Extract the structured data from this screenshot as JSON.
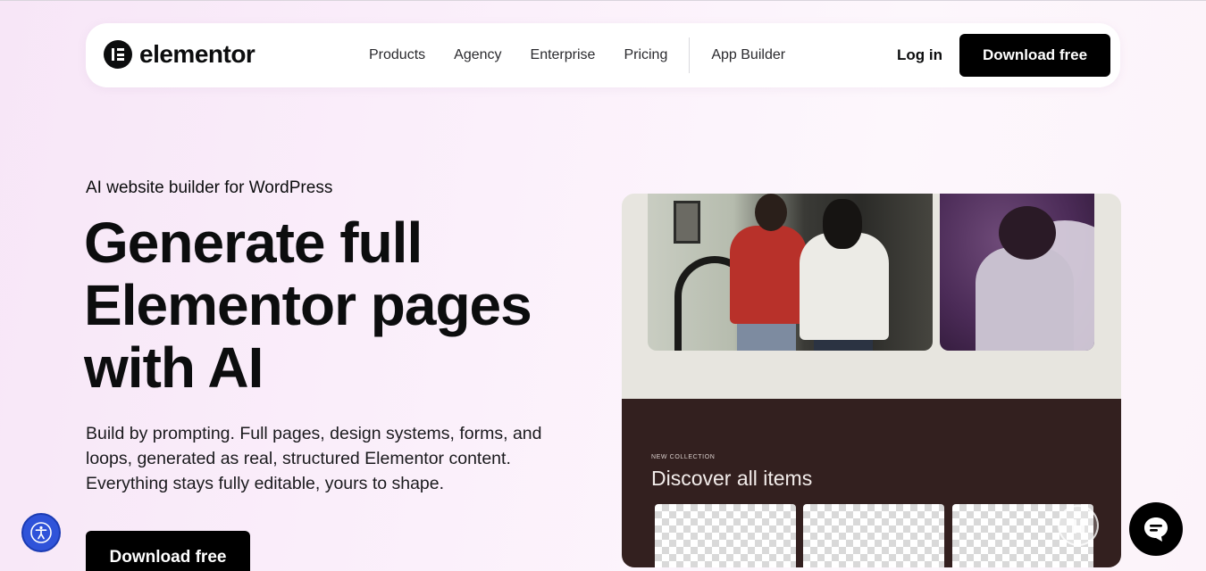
{
  "nav": {
    "logo_text": "elementor",
    "links": [
      {
        "label": "Products"
      },
      {
        "label": "Agency"
      },
      {
        "label": "Enterprise"
      },
      {
        "label": "Pricing"
      }
    ],
    "app_builder": "App Builder",
    "login": "Log in",
    "cta": "Download free"
  },
  "hero": {
    "eyebrow": "AI website builder for WordPress",
    "headline_line1": "Generate full",
    "headline_line2": "Elementor pages",
    "headline_line3": "with AI",
    "description": "Build by prompting. Full pages, design systems, forms, and loops, generated as real, structured Elementor content. Everything stays fully editable, yours to shape.",
    "cta": "Download free"
  },
  "mockup": {
    "collection_label": "NEW COLLECTION",
    "collection_title": "Discover all items"
  },
  "colors": {
    "accent": "#000000",
    "panel_dark": "#33201f",
    "accessibility_blue": "#2f53d9"
  },
  "icons": {
    "accessibility": "accessibility-icon",
    "chat": "chat-icon",
    "pause": "pause-icon"
  }
}
